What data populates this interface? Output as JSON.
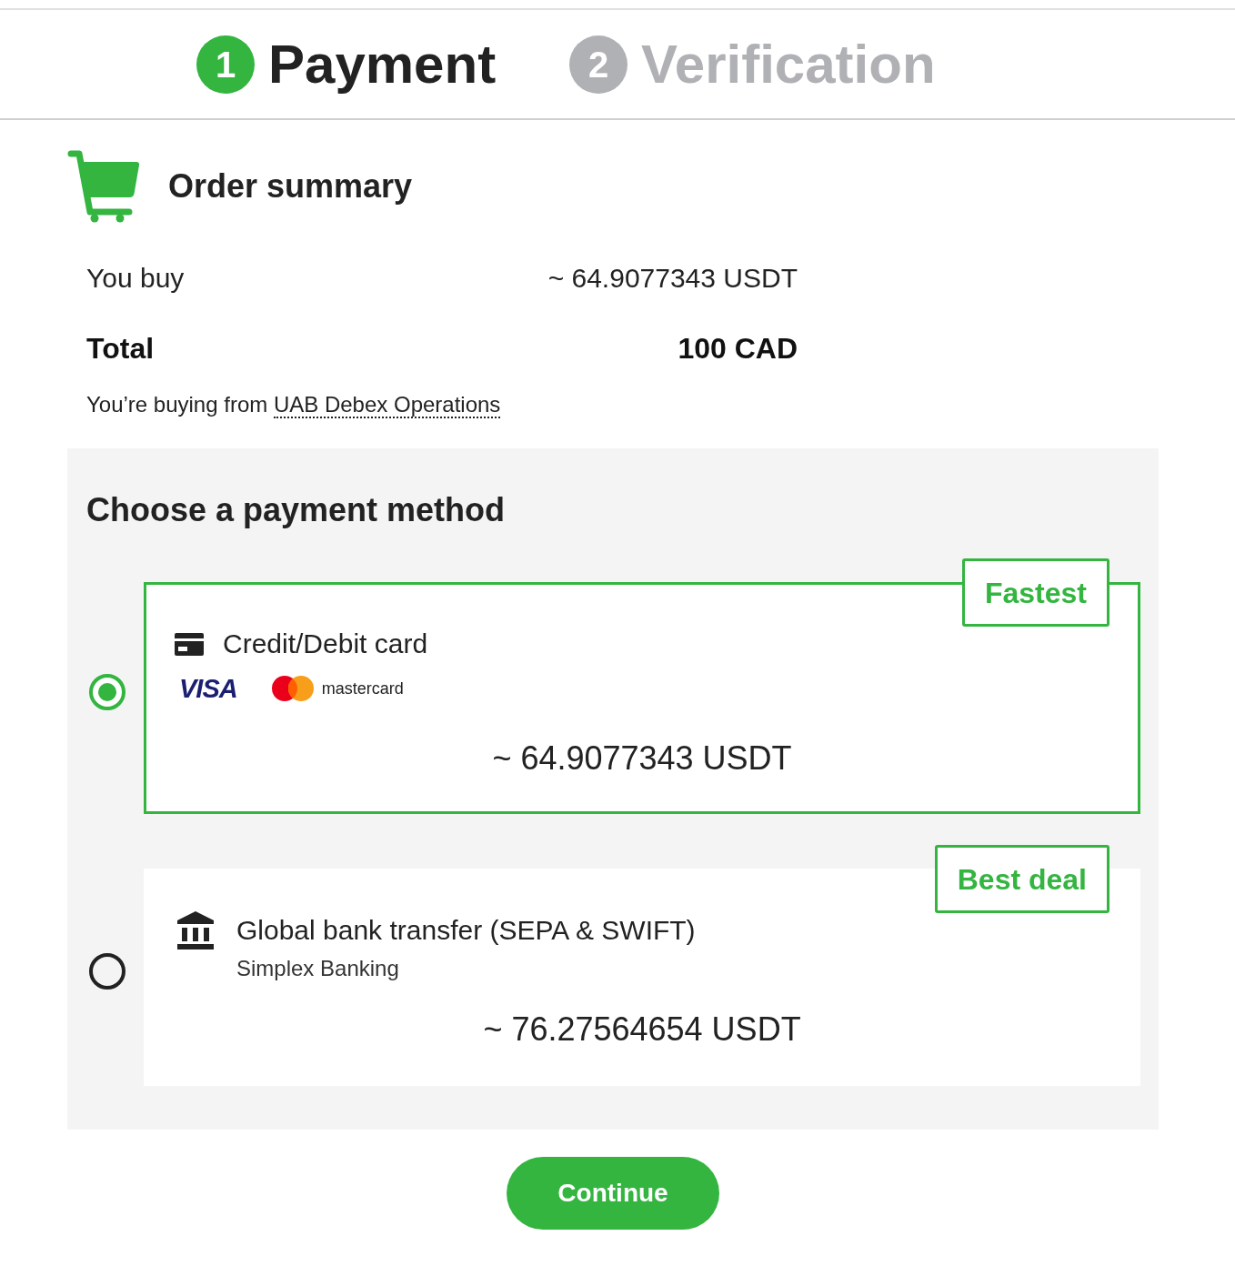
{
  "steps": [
    {
      "number": "1",
      "label": "Payment",
      "selected": true
    },
    {
      "number": "2",
      "label": "Verification",
      "selected": false
    }
  ],
  "order_summary": {
    "title": "Order summary",
    "rows": [
      {
        "kind": "normal",
        "label": "You buy",
        "value": "~ 64.9077343 USDT"
      },
      {
        "kind": "total",
        "label": "Total",
        "value": "100 CAD"
      }
    ],
    "seller": {
      "text": "You’re buying from",
      "link": "UAB Debex Operations"
    }
  },
  "payment_methods": {
    "title": "Choose a payment method",
    "options": [
      {
        "kind": "card",
        "selected": true,
        "badge": "Fastest",
        "label": "Credit/Debit card",
        "logos": [
          {
            "kind": "visa",
            "text": "VISA"
          },
          {
            "kind": "mastercard",
            "text": "mastercard"
          }
        ],
        "amount": "~ 64.9077343 USDT"
      },
      {
        "kind": "bank",
        "selected": false,
        "badge": "Best deal",
        "label": "Global bank transfer (SEPA & SWIFT)",
        "subtitle": "Simplex Banking",
        "amount": "~ 76.27564654 USDT"
      }
    ]
  },
  "continue_button": "Continue"
}
